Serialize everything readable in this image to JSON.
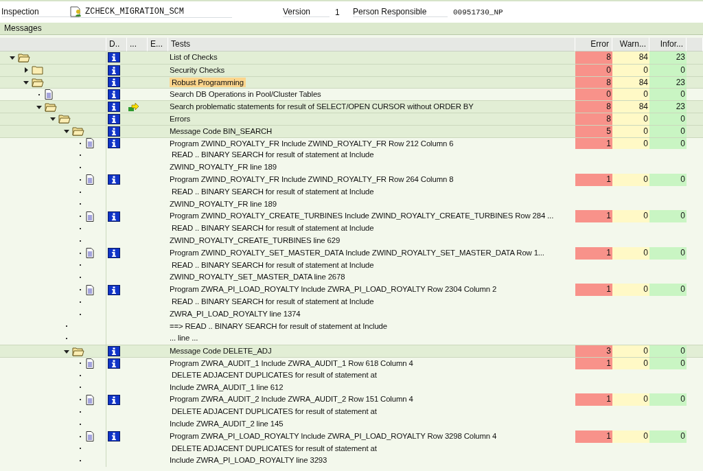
{
  "header": {
    "inspection_label": "Inspection",
    "inspection_value": "ZCHECK_MIGRATION_SCM",
    "version_label": "Version",
    "version_value": "1",
    "person_label": "Person Responsible",
    "person_value": "00951730_NP"
  },
  "panel_title": "Messages",
  "columns": [
    "D..",
    "...",
    "E...",
    "Tests",
    "Error",
    "Warn...",
    "Infor..."
  ],
  "tree": [
    {
      "text": "List of Checks",
      "kind": "folder",
      "expanded": true,
      "info": true,
      "arrow": false,
      "selected": false,
      "counts": [
        "8",
        "84",
        "23"
      ],
      "children": [
        {
          "text": "Security Checks",
          "kind": "folder",
          "expanded": false,
          "info": true,
          "arrow": false,
          "selected": false,
          "counts": [
            "0",
            "0",
            "0"
          ]
        },
        {
          "text": "Robust Programming",
          "kind": "folder",
          "expanded": true,
          "info": true,
          "arrow": false,
          "selected": true,
          "counts": [
            "8",
            "84",
            "23"
          ],
          "children": [
            {
              "text": "Search DB Operations in Pool/Cluster Tables",
              "kind": "doc",
              "info": true,
              "arrow": false,
              "selected": false,
              "counts": [
                "0",
                "0",
                "0"
              ]
            },
            {
              "text": "Search problematic statements for result of SELECT/OPEN CURSOR without ORDER BY",
              "kind": "folder",
              "expanded": true,
              "info": true,
              "arrow": true,
              "selected": false,
              "counts": [
                "8",
                "84",
                "23"
              ],
              "children": [
                {
                  "text": "Errors",
                  "kind": "folder",
                  "expanded": true,
                  "info": true,
                  "arrow": false,
                  "selected": false,
                  "counts": [
                    "8",
                    "0",
                    "0"
                  ],
                  "children": [
                    {
                      "text": "Message Code BIN_SEARCH",
                      "kind": "folder",
                      "expanded": true,
                      "info": true,
                      "arrow": false,
                      "selected": false,
                      "counts": [
                        "5",
                        "0",
                        "0"
                      ],
                      "children": [
                        {
                          "text": "Program ZWIND_ROYALTY_FR Include ZWIND_ROYALTY_FR Row 212 Column 6",
                          "kind": "doc",
                          "info": true,
                          "arrow": false,
                          "selected": false,
                          "counts": [
                            "1",
                            "0",
                            "0"
                          ]
                        },
                        {
                          "text": " READ .. BINARY SEARCH for result of statement at Include",
                          "kind": "line",
                          "info": false,
                          "arrow": false,
                          "selected": false
                        },
                        {
                          "text": "ZWIND_ROYALTY_FR line 189",
                          "kind": "line",
                          "info": false,
                          "arrow": false,
                          "selected": false
                        },
                        {
                          "text": "Program ZWIND_ROYALTY_FR Include ZWIND_ROYALTY_FR Row 264 Column 8",
                          "kind": "doc",
                          "info": true,
                          "arrow": false,
                          "selected": false,
                          "counts": [
                            "1",
                            "0",
                            "0"
                          ]
                        },
                        {
                          "text": " READ .. BINARY SEARCH for result of statement at Include",
                          "kind": "line",
                          "info": false,
                          "arrow": false,
                          "selected": false
                        },
                        {
                          "text": "ZWIND_ROYALTY_FR line 189",
                          "kind": "line",
                          "info": false,
                          "arrow": false,
                          "selected": false
                        },
                        {
                          "text": "Program ZWIND_ROYALTY_CREATE_TURBINES Include ZWIND_ROYALTY_CREATE_TURBINES Row 284 ...",
                          "kind": "doc",
                          "info": true,
                          "arrow": false,
                          "selected": false,
                          "counts": [
                            "1",
                            "0",
                            "0"
                          ]
                        },
                        {
                          "text": " READ .. BINARY SEARCH for result of statement at Include",
                          "kind": "line",
                          "info": false,
                          "arrow": false,
                          "selected": false
                        },
                        {
                          "text": "ZWIND_ROYALTY_CREATE_TURBINES line 629",
                          "kind": "line",
                          "info": false,
                          "arrow": false,
                          "selected": false
                        },
                        {
                          "text": "Program ZWIND_ROYALTY_SET_MASTER_DATA Include ZWIND_ROYALTY_SET_MASTER_DATA Row 1...",
                          "kind": "doc",
                          "info": true,
                          "arrow": false,
                          "selected": false,
                          "counts": [
                            "1",
                            "0",
                            "0"
                          ]
                        },
                        {
                          "text": " READ .. BINARY SEARCH for result of statement at Include",
                          "kind": "line",
                          "info": false,
                          "arrow": false,
                          "selected": false
                        },
                        {
                          "text": "ZWIND_ROYALTY_SET_MASTER_DATA line 2678",
                          "kind": "line",
                          "info": false,
                          "arrow": false,
                          "selected": false
                        },
                        {
                          "text": "Program ZWRA_PI_LOAD_ROYALTY Include ZWRA_PI_LOAD_ROYALTY Row 2304 Column 2",
                          "kind": "doc",
                          "info": true,
                          "arrow": false,
                          "selected": false,
                          "counts": [
                            "1",
                            "0",
                            "0"
                          ]
                        },
                        {
                          "text": " READ .. BINARY SEARCH for result of statement at Include",
                          "kind": "line",
                          "info": false,
                          "arrow": false,
                          "selected": false
                        },
                        {
                          "text": "ZWRA_PI_LOAD_ROYALTY line 1374",
                          "kind": "line",
                          "info": false,
                          "arrow": false,
                          "selected": false
                        }
                      ]
                    },
                    {
                      "text": "==> READ .. BINARY SEARCH for result of statement at Include",
                      "kind": "line",
                      "info": false,
                      "arrow": false,
                      "selected": false
                    },
                    {
                      "text": "... line ...",
                      "kind": "line",
                      "info": false,
                      "arrow": false,
                      "selected": false
                    },
                    {
                      "text": "Message Code DELETE_ADJ",
                      "kind": "folder",
                      "expanded": true,
                      "info": true,
                      "arrow": false,
                      "selected": false,
                      "counts": [
                        "3",
                        "0",
                        "0"
                      ],
                      "children": [
                        {
                          "text": "Program ZWRA_AUDIT_1 Include ZWRA_AUDIT_1 Row 618 Column 4",
                          "kind": "doc",
                          "info": true,
                          "arrow": false,
                          "selected": false,
                          "counts": [
                            "1",
                            "0",
                            "0"
                          ]
                        },
                        {
                          "text": " DELETE ADJACENT DUPLICATES for result of statement at",
                          "kind": "line",
                          "info": false,
                          "arrow": false,
                          "selected": false
                        },
                        {
                          "text": "Include ZWRA_AUDIT_1 line 612",
                          "kind": "line",
                          "info": false,
                          "arrow": false,
                          "selected": false
                        },
                        {
                          "text": "Program ZWRA_AUDIT_2 Include ZWRA_AUDIT_2 Row 151 Column 4",
                          "kind": "doc",
                          "info": true,
                          "arrow": false,
                          "selected": false,
                          "counts": [
                            "1",
                            "0",
                            "0"
                          ]
                        },
                        {
                          "text": " DELETE ADJACENT DUPLICATES for result of statement at",
                          "kind": "line",
                          "info": false,
                          "arrow": false,
                          "selected": false
                        },
                        {
                          "text": "Include ZWRA_AUDIT_2 line 145",
                          "kind": "line",
                          "info": false,
                          "arrow": false,
                          "selected": false
                        },
                        {
                          "text": "Program ZWRA_PI_LOAD_ROYALTY Include ZWRA_PI_LOAD_ROYALTY Row 3298 Column 4",
                          "kind": "doc",
                          "info": true,
                          "arrow": false,
                          "selected": false,
                          "counts": [
                            "1",
                            "0",
                            "0"
                          ]
                        },
                        {
                          "text": " DELETE ADJACENT DUPLICATES for result of statement at",
                          "kind": "line",
                          "info": false,
                          "arrow": false,
                          "selected": false
                        },
                        {
                          "text": "Include ZWRA_PI_LOAD_ROYALTY line 3293",
                          "kind": "line",
                          "info": false,
                          "arrow": false,
                          "selected": false
                        }
                      ]
                    }
                  ]
                }
              ]
            }
          ]
        }
      ]
    }
  ]
}
